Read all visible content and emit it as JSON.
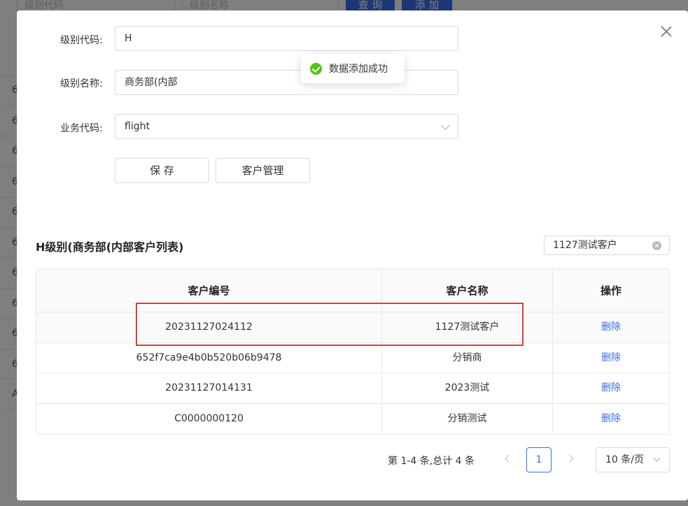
{
  "background": {
    "search_code_placeholder": "级别代码",
    "search_name_placeholder": "级别名称",
    "query_label": "查 询",
    "add_label": "添 加",
    "row_prefixes": [
      "6",
      "6",
      "6",
      "6",
      "6",
      "6",
      "6",
      "6",
      "6",
      "6",
      "A"
    ]
  },
  "form": {
    "code_label": "级别代码:",
    "code_value": "H",
    "name_label": "级别名称:",
    "name_value": "商务部(内部",
    "business_label": "业务代码:",
    "business_value": "flight",
    "save_label": "保 存",
    "customer_mgmt_label": "客户管理"
  },
  "toast": {
    "message": "数据添加成功",
    "icon": "check-circle-icon",
    "color": "#52c41a"
  },
  "list": {
    "title": "H级别(商务部(内部客户列表)",
    "search_value": "1127测试客户",
    "columns": [
      "客户编号",
      "客户名称",
      "操作"
    ],
    "rows": [
      {
        "id": "20231127024112",
        "name": "1127测试客户",
        "action": "删除"
      },
      {
        "id": "652f7ca9e4b0b520b06b9478",
        "name": "分销商",
        "action": "删除"
      },
      {
        "id": "20231127014131",
        "name": "2023测试",
        "action": "删除"
      },
      {
        "id": "C0000000120",
        "name": "分销测试",
        "action": "删除"
      }
    ]
  },
  "pagination": {
    "total_text": "第 1-4 条,总计 4 条",
    "current_page": "1",
    "page_size": "10 条/页"
  },
  "colors": {
    "accent": "#3a6ee8",
    "highlight_box": "#e03c3c"
  }
}
